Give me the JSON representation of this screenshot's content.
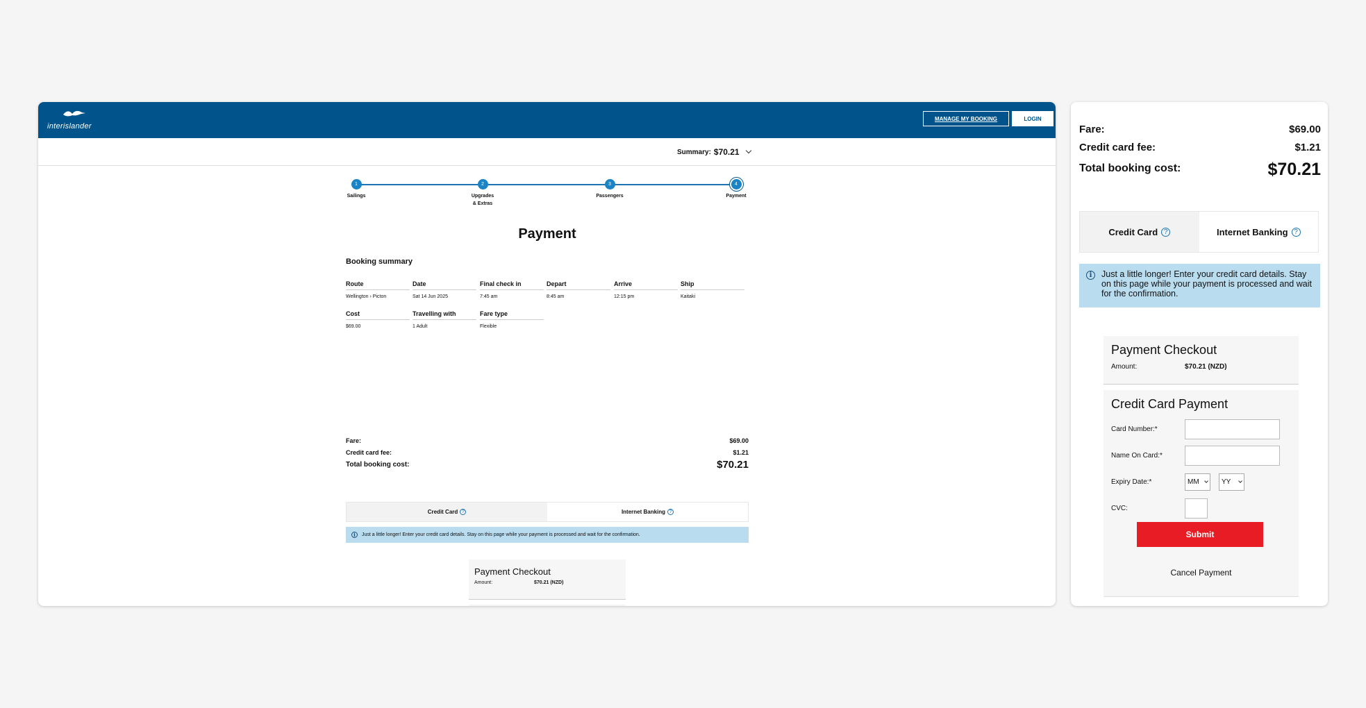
{
  "brand": {
    "name": "interislander",
    "primary": "#00538b",
    "accent": "#e81c24",
    "info_bg": "#b9dcef"
  },
  "header": {
    "manage_booking": "MANAGE MY BOOKING",
    "login": "LOGIN"
  },
  "summary": {
    "label": "Summary:",
    "amount": "$70.21"
  },
  "steps": [
    {
      "number": "1",
      "label": "Sailings"
    },
    {
      "number": "2",
      "label_line1": "Upgrades",
      "label_line2": "& Extras"
    },
    {
      "number": "3",
      "label": "Passengers"
    },
    {
      "number": "4",
      "label": "Payment"
    }
  ],
  "page_title": "Payment",
  "booking": {
    "heading": "Booking summary",
    "fields": [
      {
        "label": "Route",
        "value": "Wellington › Picton"
      },
      {
        "label": "Date",
        "value": "Sat 14 Jun 2025"
      },
      {
        "label": "Final check in",
        "value": "7:45 am"
      },
      {
        "label": "Depart",
        "value": "8:45 am"
      },
      {
        "label": "Arrive",
        "value": "12:15 pm"
      },
      {
        "label": "Ship",
        "value": "Kaitaki"
      },
      {
        "label": "Cost",
        "value": "$69.00"
      },
      {
        "label": "Travelling with",
        "value": "1 Adult"
      },
      {
        "label": "Fare type",
        "value": "Flexible"
      }
    ]
  },
  "totals": {
    "fare_label": "Fare:",
    "fare": "$69.00",
    "fee_label": "Credit card fee:",
    "fee": "$1.21",
    "total_label": "Total booking cost:",
    "total": "$70.21"
  },
  "tabs": {
    "credit_card": "Credit Card",
    "internet_banking": "Internet Banking",
    "help_glyph": "?"
  },
  "info": {
    "glyph": "i",
    "message": "Just a little longer! Enter your credit card details. Stay on this page while your payment is processed and wait for the confirmation."
  },
  "checkout": {
    "title": "Payment Checkout",
    "amount_label": "Amount:",
    "amount": "$70.21 (NZD)"
  },
  "cc_form": {
    "title": "Credit Card Payment",
    "card_number": "Card Number:*",
    "name_on_card": "Name On Card:*",
    "expiry": "Expiry Date:*",
    "month": "MM",
    "year": "YY",
    "cvc": "CVC:",
    "submit": "Submit",
    "cancel": "Cancel Payment"
  }
}
